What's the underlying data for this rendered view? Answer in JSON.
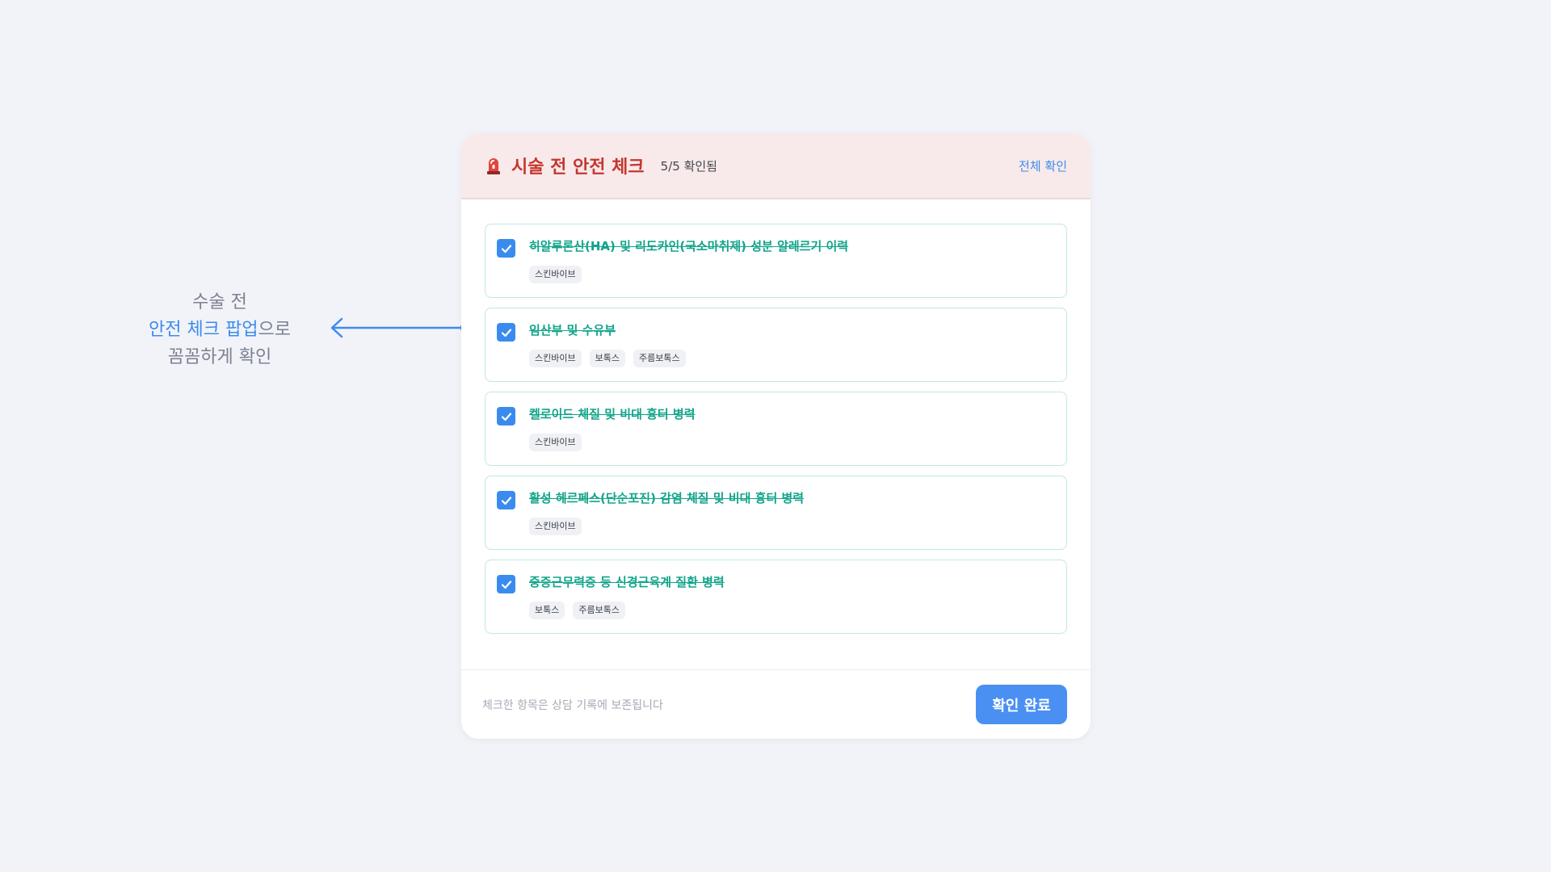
{
  "annotation": {
    "line1": "수술 전",
    "line2_highlight": "안전 체크 팝업",
    "line2_rest": "으로",
    "line3": "꼼꼼하게 확인"
  },
  "colors": {
    "accent": "#3b8bef",
    "title_red": "#c53630",
    "checked_green": "#13a48a",
    "header_bg": "#f8eaea"
  },
  "modal": {
    "icon": "siren-icon",
    "title": "시술 전 안전 체크",
    "progress": "5/5 확인됨",
    "check_all": "전체 확인",
    "items": [
      {
        "label": "히알루론산(HA) 및 리도카인(국소마취제) 성분 알레르기 이력",
        "checked": true,
        "tags": [
          "스킨바이브"
        ]
      },
      {
        "label": "임산부 및 수유부",
        "checked": true,
        "tags": [
          "스킨바이브",
          "보톡스",
          "주름보톡스"
        ]
      },
      {
        "label": "켈로이드 체질 및 비대 흉터 병력",
        "checked": true,
        "tags": [
          "스킨바이브"
        ]
      },
      {
        "label": "활성 헤르페스(단순포진) 감염 체질 및 비대 흉터 병력",
        "checked": true,
        "tags": [
          "스킨바이브"
        ]
      },
      {
        "label": "중증근무력증 등 신경근육계 질환 병력",
        "checked": true,
        "tags": [
          "보톡스",
          "주름보톡스"
        ]
      }
    ],
    "footer_note": "체크한 항목은 상담 기록에 보존됩니다",
    "confirm_label": "확인 완료"
  }
}
